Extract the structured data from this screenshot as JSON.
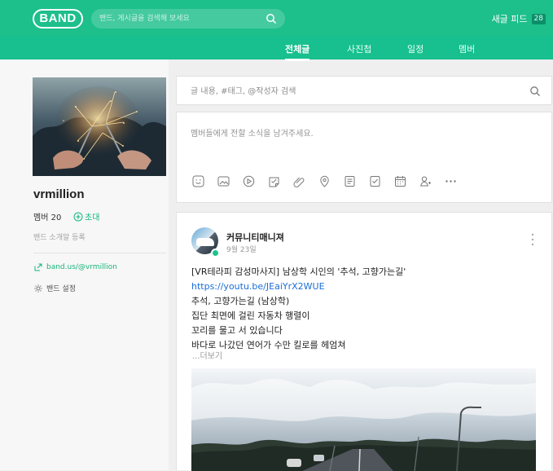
{
  "brand": {
    "logo": "BAND",
    "accent": "#1dbf8a"
  },
  "search": {
    "placeholder": "밴드, 게시글을 검색해 보세요"
  },
  "header": {
    "new_feed_label": "새글 피드",
    "new_feed_count": "28"
  },
  "tabs": [
    {
      "label": "전체글",
      "active": true
    },
    {
      "label": "사진첩",
      "active": false
    },
    {
      "label": "일정",
      "active": false
    },
    {
      "label": "멤버",
      "active": false
    }
  ],
  "band": {
    "name": "vrmillion",
    "members": "멤버 20",
    "invite": "초대",
    "intro_link": "밴드 소개말 등록",
    "url": "band.us/@vrmillion",
    "settings": "밴드 설정"
  },
  "post_search": {
    "placeholder": "글 내용, #태그, @작성자 검색"
  },
  "compose": {
    "prompt": "멤버들에게 전할 소식을 남겨주세요.",
    "tools": [
      "emoji-icon",
      "photo-icon",
      "video-icon",
      "sticker-icon",
      "attachment-icon",
      "location-icon",
      "vote-icon",
      "todo-icon",
      "schedule-icon",
      "mention-icon",
      "more-icon"
    ]
  },
  "post": {
    "author": "커뮤니티매니져",
    "date": "9월 23일",
    "lines": [
      "[VR테라피 감성마사지] 남상학 시인의 '추석, 고향가는길'",
      "https://youtu.be/JEaiYrX2WUE",
      "추석, 고향가는길 (남상학)",
      "집단 최면에 걸린 자동차 행렬이",
      "꼬리를 물고 서 있습니다",
      "바다로 나갔던 연어가 수만 킬로를 헤엄쳐"
    ],
    "more": "...더보기"
  }
}
